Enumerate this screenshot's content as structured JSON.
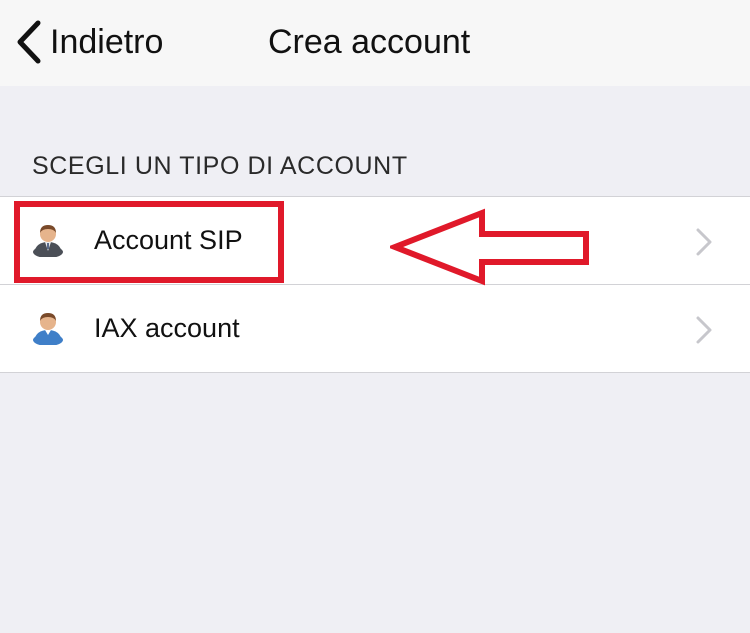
{
  "navbar": {
    "back_label": "Indietro",
    "title": "Crea account"
  },
  "section": {
    "header": "SCEGLI UN TIPO DI ACCOUNT"
  },
  "account_types": [
    {
      "label": "Account SIP",
      "icon": "user-suit-icon"
    },
    {
      "label": "IAX account",
      "icon": "user-blue-icon"
    }
  ],
  "annotation": {
    "highlight_color": "#e0192a"
  },
  "colors": {
    "background": "#efeff4",
    "navbar": "#f7f7f7",
    "row_background": "#ffffff",
    "chevron": "#c7c7cc"
  }
}
